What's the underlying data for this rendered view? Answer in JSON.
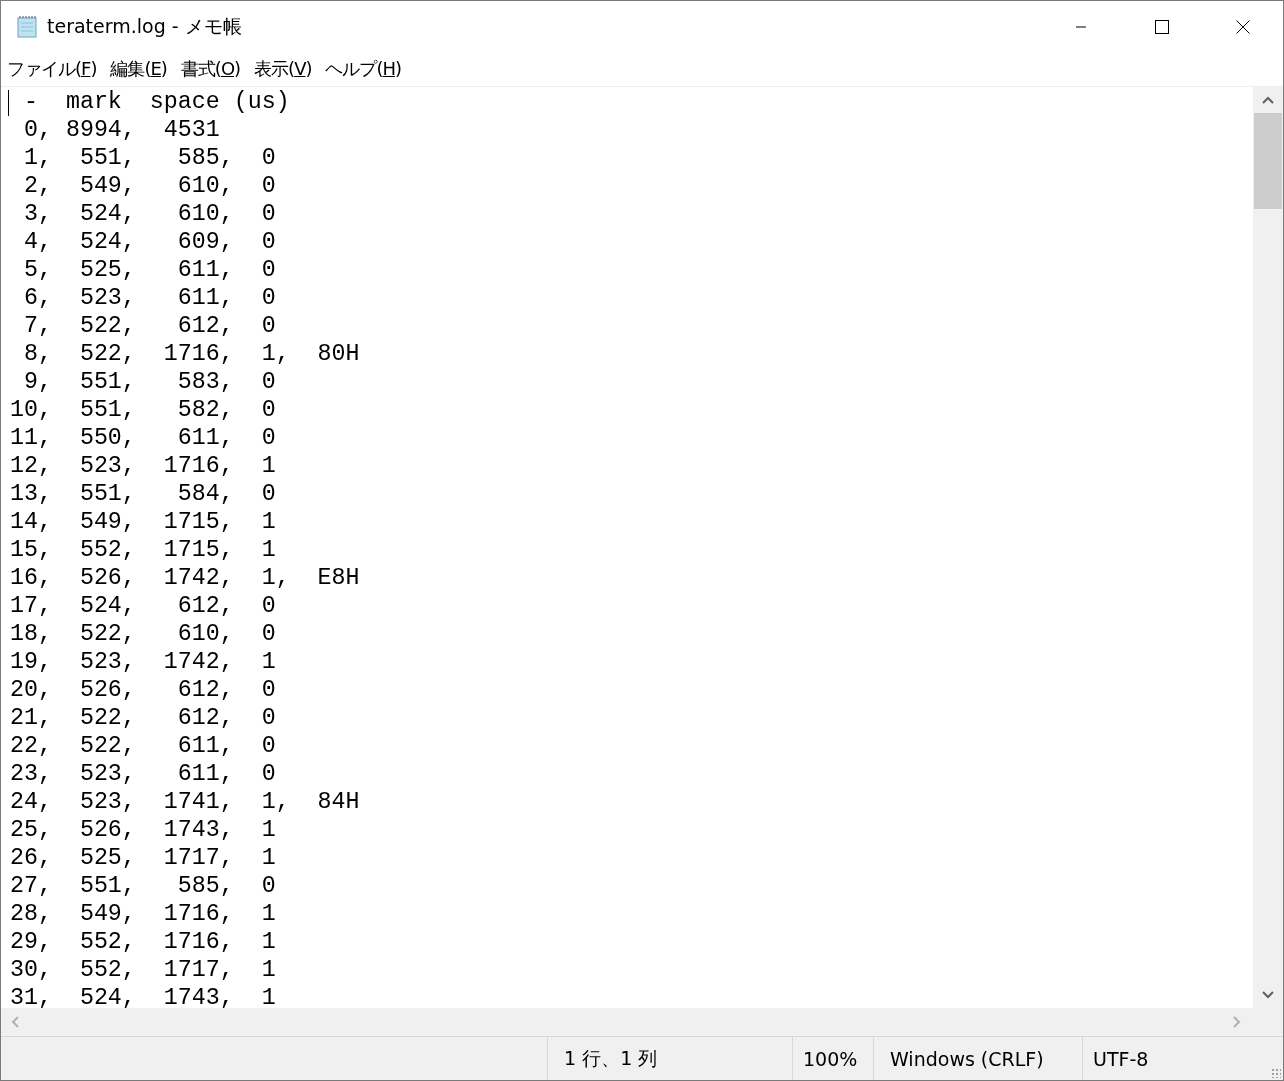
{
  "window": {
    "title": "teraterm.log - メモ帳"
  },
  "menu": [
    {
      "label": "ファイル(",
      "key": "F",
      "end": ")"
    },
    {
      "label": "編集(",
      "key": "E",
      "end": ")"
    },
    {
      "label": "書式(",
      "key": "O",
      "end": ")"
    },
    {
      "label": "表示(",
      "key": "V",
      "end": ")"
    },
    {
      "label": "ヘルプ(",
      "key": "H",
      "end": ")"
    }
  ],
  "editor": {
    "lines": [
      " -  mark  space (us)",
      " 0, 8994,  4531",
      " 1,  551,   585,  0",
      " 2,  549,   610,  0",
      " 3,  524,   610,  0",
      " 4,  524,   609,  0",
      " 5,  525,   611,  0",
      " 6,  523,   611,  0",
      " 7,  522,   612,  0",
      " 8,  522,  1716,  1,  80H",
      " 9,  551,   583,  0",
      "10,  551,   582,  0",
      "11,  550,   611,  0",
      "12,  523,  1716,  1",
      "13,  551,   584,  0",
      "14,  549,  1715,  1",
      "15,  552,  1715,  1",
      "16,  526,  1742,  1,  E8H",
      "17,  524,   612,  0",
      "18,  522,   610,  0",
      "19,  523,  1742,  1",
      "20,  526,   612,  0",
      "21,  522,   612,  0",
      "22,  522,   611,  0",
      "23,  523,   611,  0",
      "24,  523,  1741,  1,  84H",
      "25,  526,  1743,  1",
      "26,  525,  1717,  1",
      "27,  551,   585,  0",
      "28,  549,  1716,  1",
      "29,  552,  1716,  1",
      "30,  552,  1717,  1",
      "31,  524,  1743,  1"
    ]
  },
  "status_bar": [
    "1 行、1 列",
    "100%",
    "Windows (CRLF)",
    "UTF-8"
  ]
}
